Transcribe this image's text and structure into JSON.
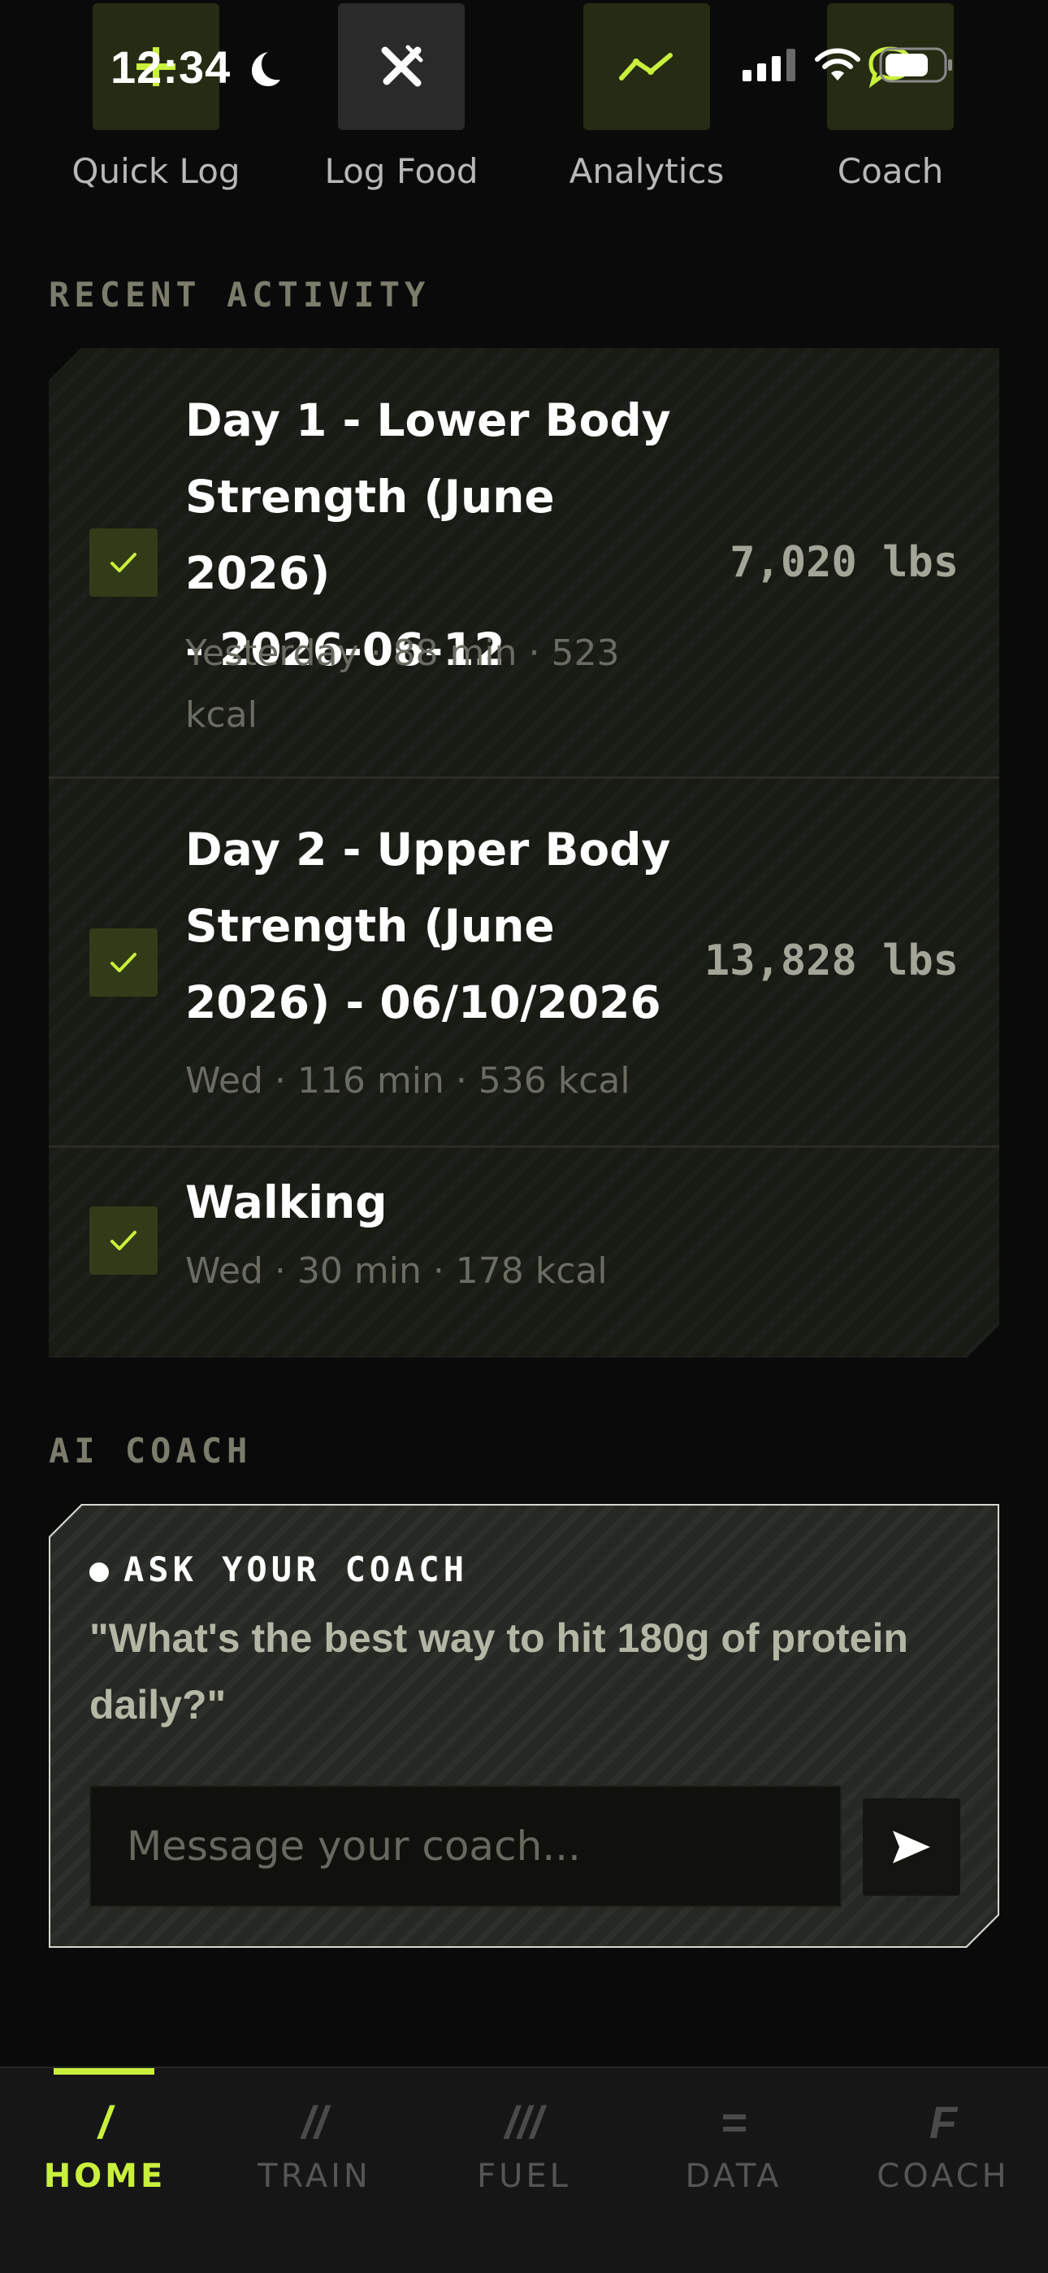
{
  "status_bar": {
    "time": "12:34"
  },
  "quick_actions": [
    {
      "label": "Quick Log",
      "icon": "plus-icon"
    },
    {
      "label": "Log Food",
      "icon": "fork-knife-icon"
    },
    {
      "label": "Analytics",
      "icon": "line-chart-icon"
    },
    {
      "label": "Coach",
      "icon": "chat-bubble-icon"
    }
  ],
  "recent_activity": {
    "title": "RECENT ACTIVITY",
    "items": [
      {
        "title_lines": [
          "Day 1 - Lower Body",
          "Strength (June 2026)",
          "- 2026-06-12"
        ],
        "meta_lines": [
          "Yesterday · 88 min · 523",
          "kcal"
        ],
        "volume": "7,020 lbs",
        "completed": true
      },
      {
        "title_lines": [
          "Day 2 - Upper Body",
          "Strength (June",
          "2026) - 06/10/2026"
        ],
        "meta_lines": [
          "Wed · 116 min · 536 kcal"
        ],
        "volume": "13,828 lbs",
        "completed": true
      },
      {
        "title_lines": [
          "Walking"
        ],
        "meta_lines": [
          "Wed · 30 min · 178 kcal"
        ],
        "volume": "",
        "completed": true
      }
    ]
  },
  "ai_coach": {
    "section_title": "AI COACH",
    "label": "ASK YOUR COACH",
    "quote_lines": [
      "\"What's the best way to hit 180g of protein",
      "daily?\""
    ],
    "input_placeholder": "Message your coach...",
    "input_value": ""
  },
  "bottom_nav": {
    "active": "home",
    "items": [
      {
        "id": "home",
        "glyph": "/",
        "label": "HOME"
      },
      {
        "id": "train",
        "glyph": "//",
        "label": "TRAIN"
      },
      {
        "id": "fuel",
        "glyph": "///",
        "label": "FUEL"
      },
      {
        "id": "data",
        "glyph": "=",
        "label": "DATA"
      },
      {
        "id": "coach",
        "glyph": "F",
        "label": "COACH"
      }
    ]
  },
  "colors": {
    "accent": "#c9f03c",
    "background": "#0a0a0a",
    "card": "#181a14",
    "muted_text": "#6b6b61"
  }
}
